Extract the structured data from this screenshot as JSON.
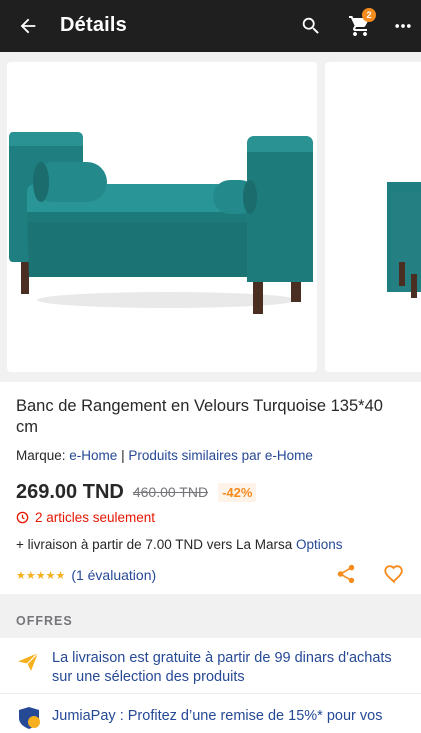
{
  "header": {
    "title": "Détails",
    "cart_count": "2",
    "icons": [
      "back-arrow-icon",
      "search-icon",
      "cart-icon",
      "more-icon"
    ]
  },
  "gallery": {
    "images": [
      "turquoise-storage-bench-front",
      "turquoise-storage-bench-side"
    ]
  },
  "product": {
    "title": "Banc de Rangement en Velours Turquoise 135*40 cm",
    "brand_label": "Marque:",
    "brand_name": "e-Home",
    "brand_separator": "|",
    "similar_link": "Produits similaires par e-Home",
    "price": "269.00 TND",
    "old_price": "460.00 TND",
    "discount": "-42%",
    "stock": "2 articles seulement",
    "delivery_text": "+ livraison à partir de 7.00 TND vers La Marsa",
    "delivery_options": "Options",
    "rating_stars": "★★★★★",
    "rating_value": 5,
    "rating_count": "(1 évaluation)"
  },
  "offers": {
    "heading": "OFFRES",
    "items": [
      {
        "icon": "paper-plane-icon",
        "text": "La livraison est gratuite à partir de 99 dinars d'achats sur une sélection des produits"
      },
      {
        "icon": "jumiapay-icon",
        "text": "JumiaPay : Profitez d’une remise de 15%* pour vos"
      }
    ]
  },
  "colors": {
    "topbar": "#1f1f1f",
    "accent": "#f68b1e",
    "link": "#264996",
    "stock_red": "#e61601",
    "star": "#f6b01e"
  }
}
